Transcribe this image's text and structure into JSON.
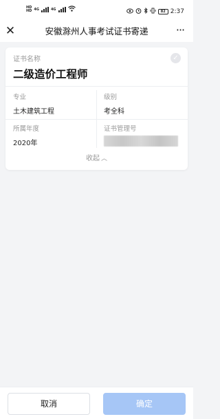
{
  "status_bar": {
    "sim1": "HD",
    "sim2": "HD",
    "net1": "4G",
    "net2": "4G",
    "battery": "82",
    "time": "2:37"
  },
  "nav": {
    "title": "安徽滁州人事考试证书寄递",
    "close_glyph": "✕",
    "more_glyph": "···"
  },
  "certificate": {
    "name_label": "证书名称",
    "name": "二级造价工程师",
    "fields": {
      "major_label": "专业",
      "major_value": "土木建筑工程",
      "level_label": "级别",
      "level_value": "考全科",
      "year_label": "所属年度",
      "year_value": "2020年",
      "number_label": "证书管理号"
    },
    "collapse_label": "收起",
    "collapse_glyph": "︿"
  },
  "footer": {
    "cancel_label": "取消",
    "confirm_label": "确定"
  },
  "colors": {
    "background": "#f3f4f6",
    "confirm_disabled": "#a6c6f6",
    "muted_text": "#999999"
  }
}
